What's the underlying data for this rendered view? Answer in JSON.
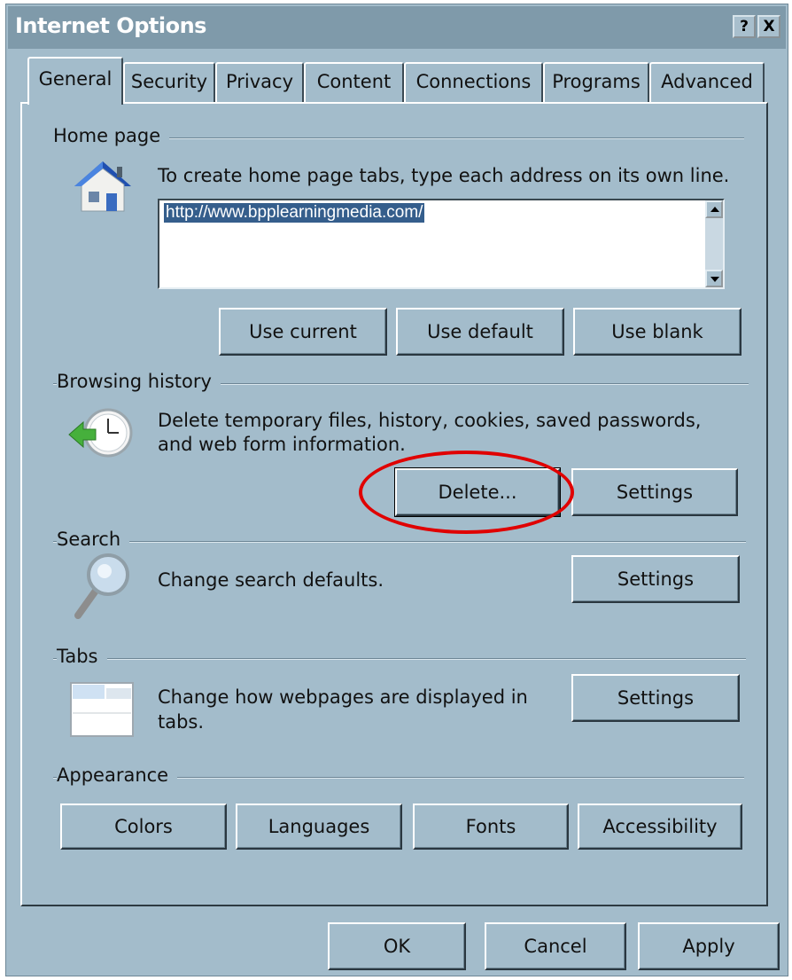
{
  "window": {
    "title": "Internet Options",
    "help_button": "?",
    "close_button": "X"
  },
  "tabs": [
    {
      "label": "General",
      "active": true
    },
    {
      "label": "Security",
      "active": false
    },
    {
      "label": "Privacy",
      "active": false
    },
    {
      "label": "Content",
      "active": false
    },
    {
      "label": "Connections",
      "active": false
    },
    {
      "label": "Programs",
      "active": false
    },
    {
      "label": "Advanced",
      "active": false
    }
  ],
  "home_page": {
    "group_label": "Home page",
    "icon": "house-icon",
    "description": "To create home page tabs, type each address on its own line.",
    "address": "http://www.bpplearningmedia.com/",
    "buttons": {
      "use_current": "Use current",
      "use_default": "Use default",
      "use_blank": "Use blank"
    }
  },
  "browsing_history": {
    "group_label": "Browsing history",
    "icon": "history-clock-icon",
    "description_line1": "Delete temporary files, history, cookies, saved passwords,",
    "description_line2": "and web form information.",
    "buttons": {
      "delete": "Delete...",
      "settings": "Settings"
    }
  },
  "search": {
    "group_label": "Search",
    "icon": "magnifier-icon",
    "description": "Change search defaults.",
    "settings": "Settings"
  },
  "tabs_group": {
    "group_label": "Tabs",
    "icon": "tabs-window-icon",
    "description_line1": "Change how webpages are displayed in",
    "description_line2": "tabs.",
    "settings": "Settings"
  },
  "appearance": {
    "group_label": "Appearance",
    "buttons": {
      "colors": "Colors",
      "languages": "Languages",
      "fonts": "Fonts",
      "accessibility": "Accessibility"
    }
  },
  "footer": {
    "ok": "OK",
    "cancel": "Cancel",
    "apply": "Apply"
  },
  "colors": {
    "dialog_bg": "#a3bccb",
    "titlebar": "#7f9aaa",
    "annotation": "#e00000",
    "selection": "#355e8c"
  }
}
